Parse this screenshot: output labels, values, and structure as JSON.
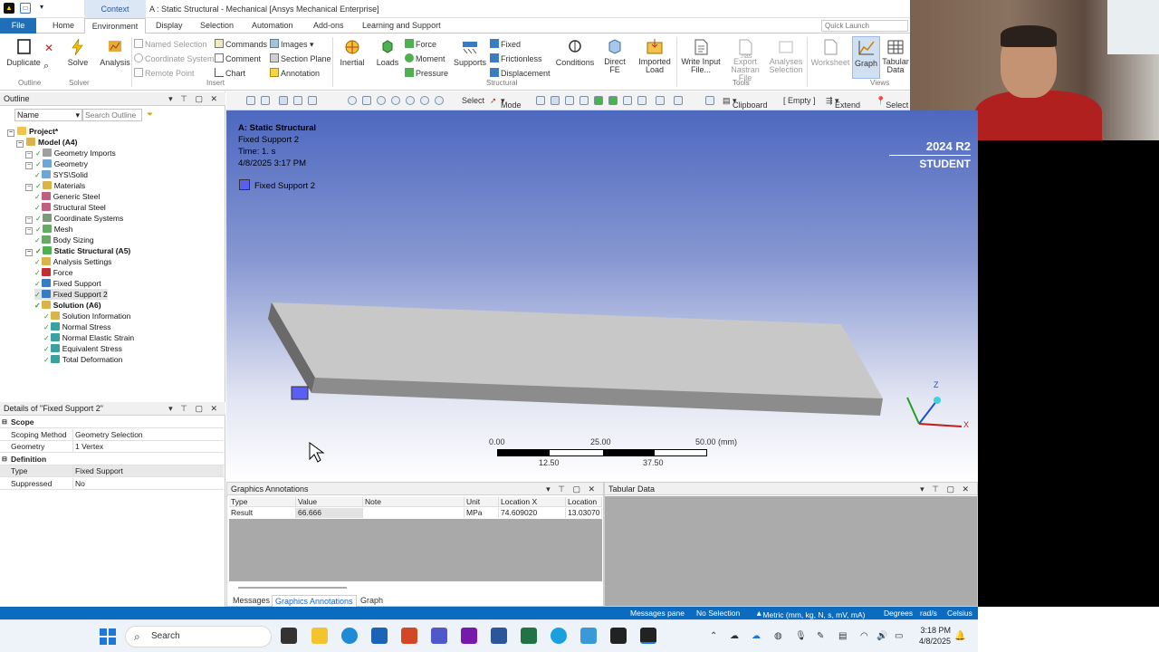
{
  "window": {
    "title": "A : Static Structural - Mechanical [Ansys Mechanical Enterprise]",
    "context_tab": "Context",
    "quick_launch_placeholder": "Quick Launch"
  },
  "tabs": [
    "File",
    "Home",
    "Environment",
    "Display",
    "Selection",
    "Automation",
    "Add-ons",
    "Learning and Support"
  ],
  "ribbon": {
    "duplicate": "Duplicate",
    "solve": "Solve",
    "analysis": "Analysis",
    "named_selection": "Named Selection",
    "coordinate_system": "Coordinate System",
    "remote_point": "Remote Point",
    "commands": "Commands",
    "comment": "Comment",
    "chart": "Chart",
    "images": "Images",
    "section_plane": "Section Plane",
    "annotation": "Annotation",
    "inertial": "Inertial",
    "loads": "Loads",
    "force": "Force",
    "moment": "Moment",
    "pressure": "Pressure",
    "supports": "Supports",
    "fixed": "Fixed",
    "frictionless": "Frictionless",
    "displacement": "Displacement",
    "conditions": "Conditions",
    "direct_fe": "Direct FE",
    "imported_load": "Imported Load",
    "write_input_file": "Write Input File...",
    "export_nastran": "Export Nastran File",
    "nas_label": ".nas",
    "analyses_selection": "Analyses Selection",
    "worksheet": "Worksheet",
    "graph": "Graph",
    "tabular_data": "Tabular Data",
    "groups": {
      "outline": "Outline",
      "solver": "Solver",
      "insert": "Insert",
      "structural": "Structural",
      "tools": "Tools",
      "views": "Views"
    }
  },
  "toolbar": {
    "select": "Select",
    "mode": "Mode",
    "clipboard": "Clipboard",
    "empty": "[ Empty ]",
    "extend": "Extend",
    "select2": "Select"
  },
  "outline": {
    "title": "Outline",
    "filter_name": "Name",
    "search_placeholder": "Search Outline",
    "tree": [
      {
        "label": "Project*",
        "level": 0,
        "bold": true,
        "icon": "project-icon"
      },
      {
        "label": "Model (A4)",
        "level": 1,
        "bold": true,
        "icon": "model-icon"
      },
      {
        "label": "Geometry Imports",
        "level": 2,
        "icon": "geometry-imports-icon"
      },
      {
        "label": "Geometry",
        "level": 2,
        "icon": "geometry-icon"
      },
      {
        "label": "SYS\\Solid",
        "level": 3,
        "icon": "solid-icon"
      },
      {
        "label": "Materials",
        "level": 2,
        "icon": "materials-icon"
      },
      {
        "label": "Generic Steel",
        "level": 3,
        "icon": "material-icon"
      },
      {
        "label": "Structural Steel",
        "level": 3,
        "icon": "material-icon"
      },
      {
        "label": "Coordinate Systems",
        "level": 2,
        "icon": "coordinate-systems-icon"
      },
      {
        "label": "Mesh",
        "level": 2,
        "icon": "mesh-icon"
      },
      {
        "label": "Body Sizing",
        "level": 3,
        "icon": "body-sizing-icon"
      },
      {
        "label": "Static Structural (A5)",
        "level": 2,
        "bold": true,
        "icon": "static-structural-icon"
      },
      {
        "label": "Analysis Settings",
        "level": 3,
        "icon": "analysis-settings-icon"
      },
      {
        "label": "Force",
        "level": 3,
        "icon": "force-icon"
      },
      {
        "label": "Fixed Support",
        "level": 3,
        "icon": "fixed-support-icon"
      },
      {
        "label": "Fixed Support 2",
        "level": 3,
        "icon": "fixed-support-icon",
        "selected": true
      },
      {
        "label": "Solution (A6)",
        "level": 3,
        "bold": true,
        "icon": "solution-icon"
      },
      {
        "label": "Solution Information",
        "level": 4,
        "icon": "solution-information-icon"
      },
      {
        "label": "Normal Stress",
        "level": 4,
        "icon": "result-icon"
      },
      {
        "label": "Normal Elastic Strain",
        "level": 4,
        "icon": "result-icon"
      },
      {
        "label": "Equivalent Stress",
        "level": 4,
        "icon": "result-icon"
      },
      {
        "label": "Total Deformation",
        "level": 4,
        "icon": "result-icon"
      }
    ]
  },
  "details": {
    "title": "Details of \"Fixed Support 2\"",
    "rows": [
      {
        "section": "Scope"
      },
      {
        "key": "Scoping Method",
        "value": "Geometry Selection"
      },
      {
        "key": "Geometry",
        "value": "1 Vertex"
      },
      {
        "section": "Definition"
      },
      {
        "key": "Type",
        "value": "Fixed Support"
      },
      {
        "key": "Suppressed",
        "value": "No"
      }
    ]
  },
  "viewport": {
    "line1": "A: Static Structural",
    "line2": "Fixed Support 2",
    "line3": "Time: 1. s",
    "line4": "4/8/2025 3:17 PM",
    "legend": "Fixed Support 2",
    "brand_version": "2024 R2",
    "brand_student": "STUDENT",
    "scale": {
      "top": [
        "0.00",
        "25.00",
        "50.00 (mm)"
      ],
      "bottom": [
        "12.50",
        "37.50"
      ]
    },
    "axis_z": "Z",
    "axis_x": "X"
  },
  "graphics_annotations": {
    "title": "Graphics Annotations",
    "columns": [
      "Type",
      "Value",
      "Note",
      "Unit",
      "Location X",
      "Location"
    ],
    "rows": [
      [
        "Result",
        "66.666",
        "",
        "MPa",
        "74.609020",
        "13.03070"
      ]
    ],
    "bottom_tabs": [
      "Messages",
      "Graphics Annotations",
      "Graph"
    ]
  },
  "tabular_data": {
    "title": "Tabular Data"
  },
  "status": {
    "messages": "Messages pane",
    "selection": "No Selection",
    "units": "Metric (mm, kg, N, s, mV, mA)",
    "degrees": "Degrees",
    "rads": "rad/s",
    "temp": "Celsius"
  },
  "taskbar": {
    "search": "Search",
    "time": "3:18 PM",
    "date": "4/8/2025"
  }
}
